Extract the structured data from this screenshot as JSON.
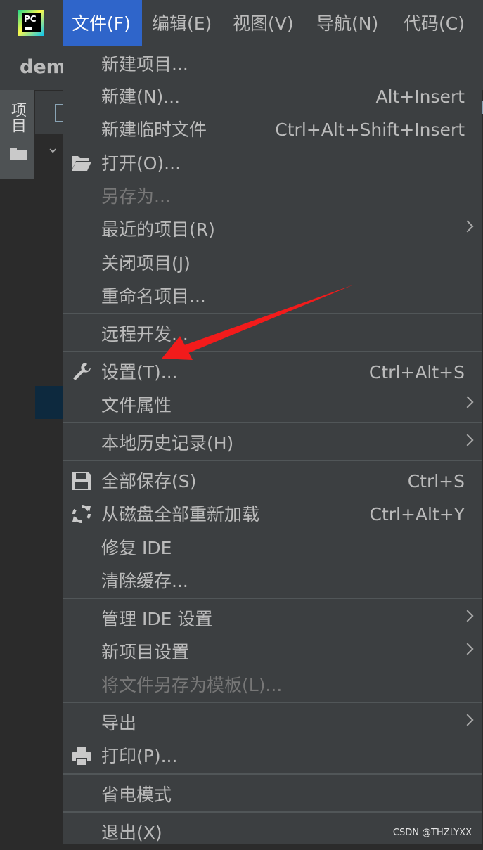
{
  "menubar": {
    "logo_text": "PC",
    "items": [
      {
        "label": "文件(F)"
      },
      {
        "label": "编辑(E)"
      },
      {
        "label": "视图(V)"
      },
      {
        "label": "导航(N)"
      },
      {
        "label": "代码(C)"
      }
    ]
  },
  "background": {
    "project_name": "dem",
    "side_tab_label": "项目"
  },
  "file_menu": {
    "new_project": "新建项目...",
    "new": {
      "label": "新建(N)...",
      "shortcut": "Alt+Insert"
    },
    "new_scratch": {
      "label": "新建临时文件",
      "shortcut": "Ctrl+Alt+Shift+Insert"
    },
    "open": "打开(O)...",
    "save_as": "另存为...",
    "recent_projects": "最近的项目(R)",
    "close_project": "关闭项目(J)",
    "rename_project": "重命名项目...",
    "remote_dev": "远程开发...",
    "settings": {
      "label": "设置(T)...",
      "shortcut": "Ctrl+Alt+S"
    },
    "file_properties": "文件属性",
    "local_history": "本地历史记录(H)",
    "save_all": {
      "label": "全部保存(S)",
      "shortcut": "Ctrl+S"
    },
    "reload_all": {
      "label": "从磁盘全部重新加载",
      "shortcut": "Ctrl+Alt+Y"
    },
    "repair_ide": "修复 IDE",
    "invalidate_caches": "清除缓存...",
    "manage_ide_settings": "管理 IDE 设置",
    "new_project_settings": "新项目设置",
    "save_as_template": "将文件另存为模板(L)...",
    "export": "导出",
    "print": "打印(P)...",
    "power_save": "省电模式",
    "exit": "退出(X)"
  },
  "watermark": "CSDN @THZLYXX",
  "colors": {
    "menu_bg": "#3c3f41",
    "active_menu": "#2f65ca",
    "annotation_arrow": "#f21b1b"
  }
}
